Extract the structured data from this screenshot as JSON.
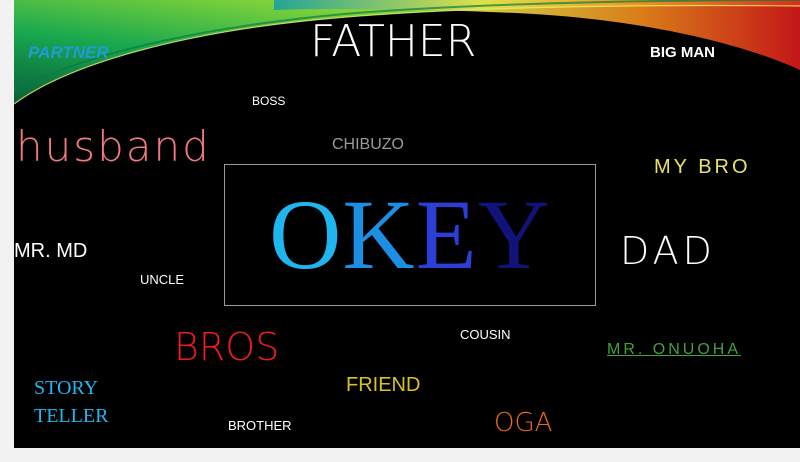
{
  "colors": {
    "background": "#000000",
    "okey_o": "#1fb6f0",
    "okey_k": "#1a8fe3",
    "okey_e": "#2a3fd6",
    "okey_y": "#12137a"
  },
  "words": {
    "partner": "PARTNER",
    "father": "FATHER",
    "big_man": "BIG MAN",
    "boss": "BOSS",
    "husband": "husband",
    "chibuzo": "CHIBUZO",
    "my_bro": "MY BRO",
    "mr_md": "MR. MD",
    "dad": "DAD",
    "uncle": "UNCLE",
    "bros": "BROS",
    "cousin": "COUSIN",
    "mr_onuoha": "MR. ONUOHA",
    "story_teller_line1": "STORY",
    "story_teller_line2": "TELLER",
    "friend": "FRIEND",
    "brother": "BROTHER",
    "oga": "OGA"
  },
  "title": {
    "o": "O",
    "k": "K",
    "e": "E",
    "y": "Y"
  }
}
